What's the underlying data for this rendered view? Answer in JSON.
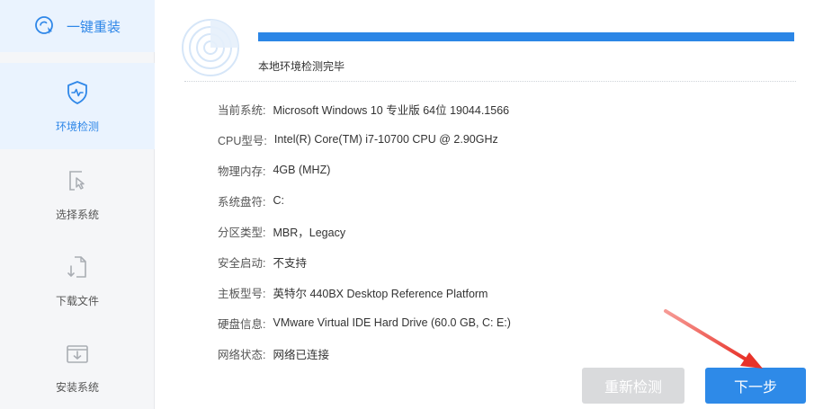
{
  "sidebar": {
    "brand": {
      "label": "一键重装",
      "icon": "reinstall-icon"
    },
    "items": [
      {
        "label": "环境检测",
        "icon": "shield-heartbeat-icon",
        "active": true
      },
      {
        "label": "选择系统",
        "icon": "select-cursor-icon",
        "active": false
      },
      {
        "label": "下载文件",
        "icon": "download-file-icon",
        "active": false
      },
      {
        "label": "安装系统",
        "icon": "install-box-icon",
        "active": false
      }
    ]
  },
  "main": {
    "progress_percent": 100,
    "status": "本地环境检测完毕",
    "info": [
      {
        "key": "当前系统:",
        "value": "Microsoft Windows 10 专业版 64位 19044.1566"
      },
      {
        "key": "CPU型号:",
        "value": "Intel(R) Core(TM) i7-10700 CPU @ 2.90GHz"
      },
      {
        "key": "物理内存:",
        "value": "4GB (MHZ)"
      },
      {
        "key": "系统盘符:",
        "value": "C:"
      },
      {
        "key": "分区类型:",
        "value": "MBR，Legacy"
      },
      {
        "key": "安全启动:",
        "value": "不支持"
      },
      {
        "key": "主板型号:",
        "value": "英特尔 440BX Desktop Reference Platform"
      },
      {
        "key": "硬盘信息:",
        "value": "VMware Virtual IDE Hard Drive  (60.0 GB, C: E:)"
      },
      {
        "key": "网络状态:",
        "value": "网络已连接"
      }
    ],
    "buttons": {
      "retest": "重新检测",
      "next": "下一步"
    }
  },
  "colors": {
    "accent": "#2b86e6",
    "arrow": "#e8332a",
    "disabled_button": "#d9dadc"
  }
}
